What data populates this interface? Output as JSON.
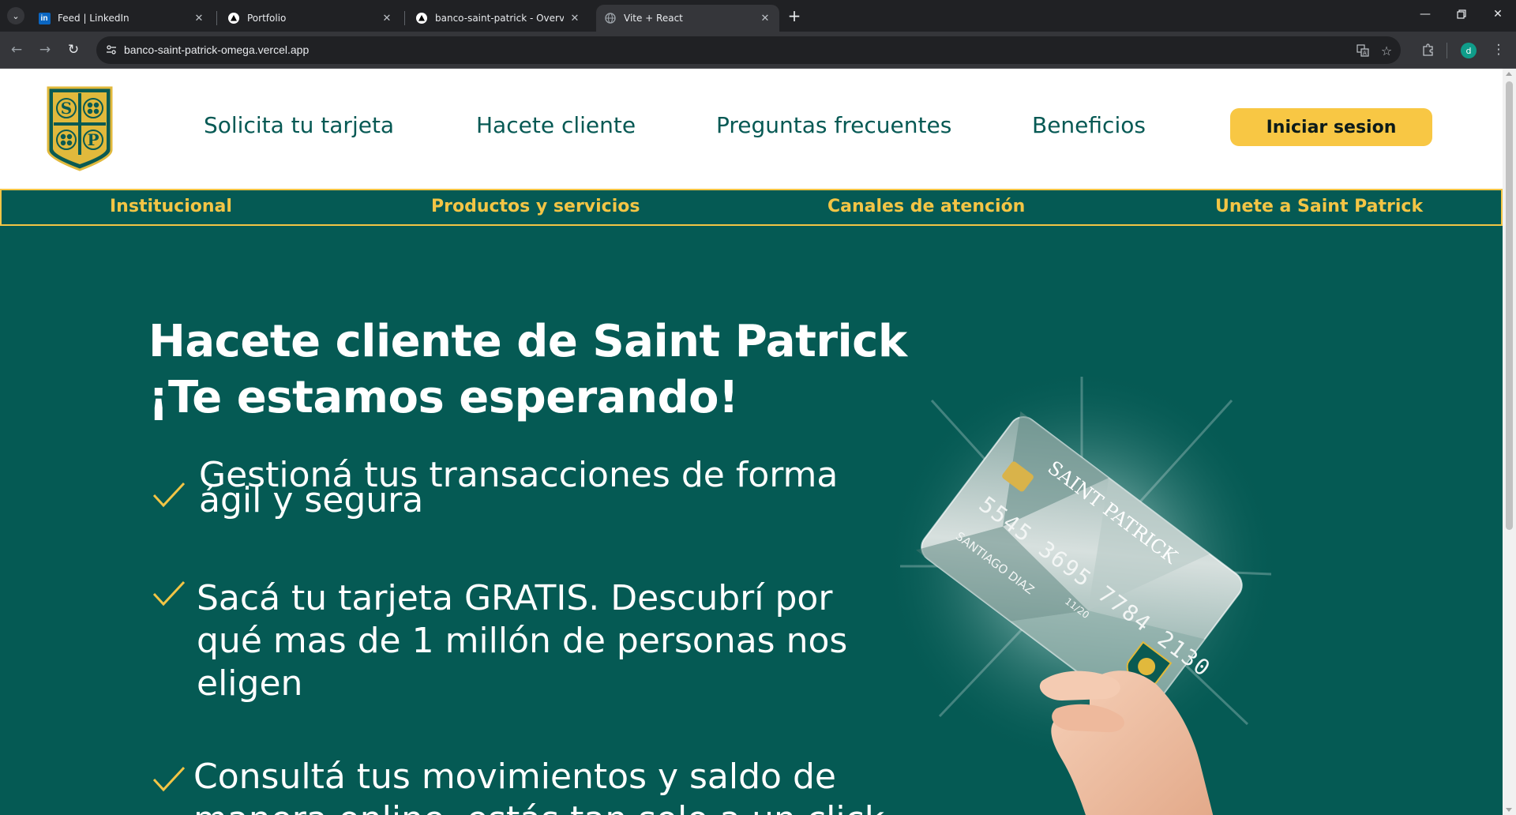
{
  "browser": {
    "tabs": [
      {
        "title": "Feed | LinkedIn",
        "icon": "linkedin-icon",
        "active": false
      },
      {
        "title": "Portfolio",
        "icon": "vercel-icon",
        "active": false
      },
      {
        "title": "banco-saint-patrick - Overview",
        "icon": "vercel-icon",
        "active": false
      },
      {
        "title": "Vite + React",
        "icon": "globe-icon",
        "active": true
      }
    ],
    "url": "banco-saint-patrick-omega.vercel.app",
    "profile_initial": "d"
  },
  "site": {
    "logo": {
      "letters": [
        "S",
        "P"
      ]
    },
    "nav": [
      "Solicita tu tarjeta",
      "Hacete cliente",
      "Preguntas frecuentes",
      "Beneficios"
    ],
    "login_label": "Iniciar sesion",
    "subnav": [
      "Institucional",
      "Productos y servicios",
      "Canales de atención",
      "Unete a Saint Patrick"
    ]
  },
  "hero": {
    "title_line1": "Hacete cliente de Saint Patrick",
    "title_line2": "¡Te estamos esperando!",
    "features": [
      {
        "lines": [
          "Gestioná tus transacciones de forma",
          "ágil y segura"
        ]
      },
      {
        "lines": [
          "Sacá tu tarjeta GRATIS. Descubrí por",
          "qué mas de 1 millón de personas nos",
          "eligen"
        ]
      },
      {
        "lines": [
          "Consultá tus movimientos y saldo de",
          "manera online, estás tan solo a un click"
        ]
      }
    ],
    "card": {
      "brand": "SAINT PATRICK",
      "number": "5545 3695 7784 2130",
      "holder": "SANTIAGO DIAZ",
      "expiry": "11/20"
    }
  },
  "colors": {
    "brand_green": "#055a54",
    "brand_yellow": "#f8c744",
    "nav_text": "#065954"
  }
}
